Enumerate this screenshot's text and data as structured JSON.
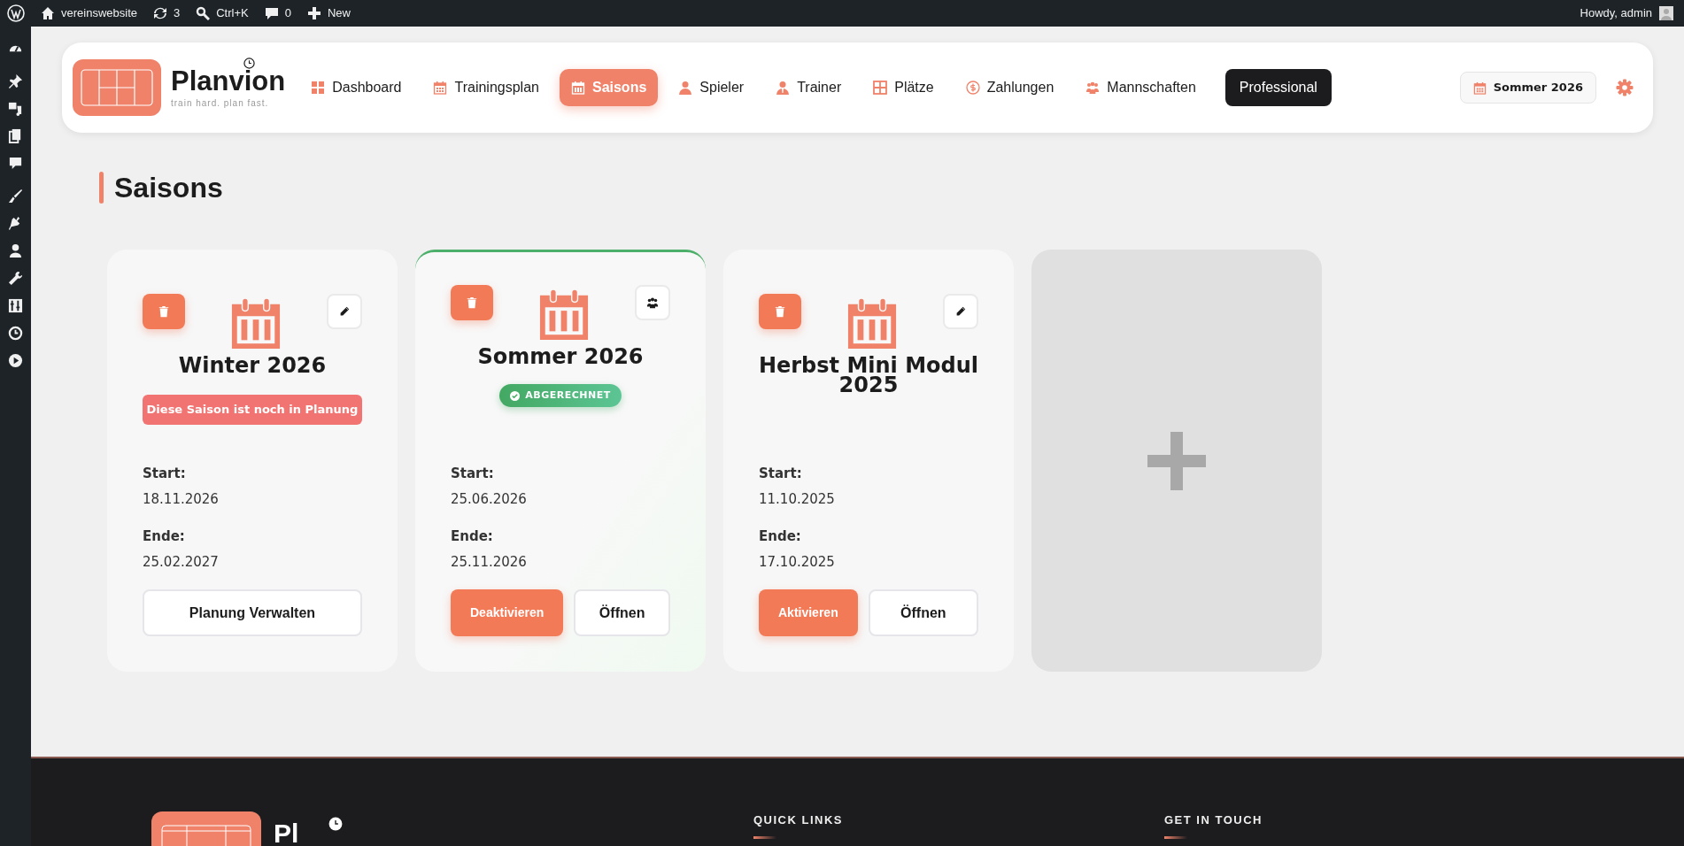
{
  "admin_bar": {
    "site": "vereinswebsite",
    "updates": "3",
    "search": "Ctrl+K",
    "comments": "0",
    "new": "New",
    "greeting": "Howdy, admin"
  },
  "header": {
    "brand": "Planvion",
    "tagline": "train hard. plan fast.",
    "nav": [
      {
        "label": "Dashboard",
        "kind": "link",
        "selected": false
      },
      {
        "label": "Trainingsplan",
        "kind": "link",
        "selected": false
      },
      {
        "label": "Saisons",
        "kind": "link",
        "selected": true
      },
      {
        "label": "Spieler",
        "kind": "link",
        "selected": false
      },
      {
        "label": "Trainer",
        "kind": "link",
        "selected": false
      },
      {
        "label": "Plätze",
        "kind": "link",
        "selected": false
      },
      {
        "label": "Zahlungen",
        "kind": "link",
        "selected": false
      },
      {
        "label": "Mannschaften",
        "kind": "link",
        "selected": false
      },
      {
        "label": "Professional",
        "kind": "plan"
      }
    ],
    "season_picker": "Sommer 2026"
  },
  "page_title": "Saisons",
  "seasons": [
    {
      "name": "Winter 2026",
      "active": false,
      "corner": {
        "kind": "edit"
      },
      "status": {
        "kind": "planning",
        "text": "Diese Saison ist noch in Planung"
      },
      "start_label": "Start:",
      "start": "18.11.2026",
      "end_label": "Ende:",
      "end": "25.02.2027",
      "actions": [
        {
          "label": "Planung Verwalten",
          "kind": "secondary"
        }
      ]
    },
    {
      "name": "Sommer 2026",
      "active": true,
      "corner": {
        "kind": "team"
      },
      "status": {
        "kind": "billed",
        "text": "ABGERECHNET"
      },
      "start_label": "Start:",
      "start": "25.06.2026",
      "end_label": "Ende:",
      "end": "25.11.2026",
      "actions": [
        {
          "label": "Deaktivieren",
          "kind": "primary"
        },
        {
          "label": "Öffnen",
          "kind": "secondary"
        }
      ]
    },
    {
      "name": "Herbst Mini Modul 2025",
      "active": false,
      "corner": {
        "kind": "edit"
      },
      "start_label": "Start:",
      "start": "11.10.2025",
      "end_label": "Ende:",
      "end": "17.10.2025",
      "actions": [
        {
          "label": "Aktivieren",
          "kind": "primary"
        },
        {
          "label": "Öffnen",
          "kind": "secondary"
        }
      ]
    }
  ],
  "footer": {
    "brand": "Pl",
    "headings": [
      "QUICK LINKS",
      "GET IN TOUCH"
    ]
  }
}
